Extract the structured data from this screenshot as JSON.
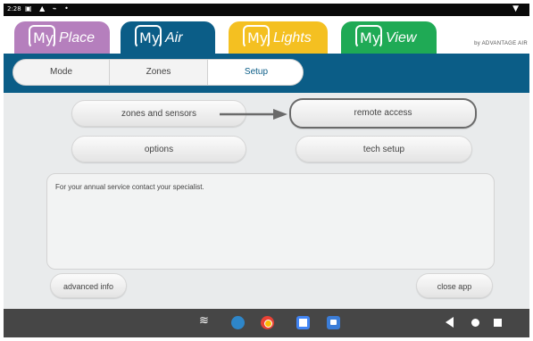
{
  "status_bar": {
    "time": "2:28",
    "icons_text": "▣ ▲  ⌁ •",
    "wifi_glyph": "▼"
  },
  "app_tabs": [
    {
      "prefix": "My",
      "name": "Place",
      "color": "#b57fbd"
    },
    {
      "prefix": "My",
      "name": "Air",
      "color": "#0b5d87"
    },
    {
      "prefix": "My",
      "name": "Lights",
      "color": "#f4c021"
    },
    {
      "prefix": "My",
      "name": "View",
      "color": "#1faa55"
    }
  ],
  "brand": "by ADVANTAGE AIR",
  "nav": {
    "tabs": [
      "Mode",
      "Zones",
      "Setup"
    ],
    "selected": "Setup"
  },
  "setup": {
    "zones_and_sensors": "zones and sensors",
    "remote_access": "remote access",
    "options": "options",
    "tech_setup": "tech setup",
    "info_message": "For your annual service contact your specialist.",
    "advanced_info": "advanced info",
    "close_app": "close app"
  },
  "system_bar": {
    "wifi_glyph": "≋",
    "apps": [
      "app-icon",
      "chrome-icon",
      "slides-icon",
      "camera-icon"
    ]
  },
  "colors": {
    "accent": "#0b5d87",
    "highlight_border": "#6a6a6a",
    "background": "#e9ebec"
  }
}
